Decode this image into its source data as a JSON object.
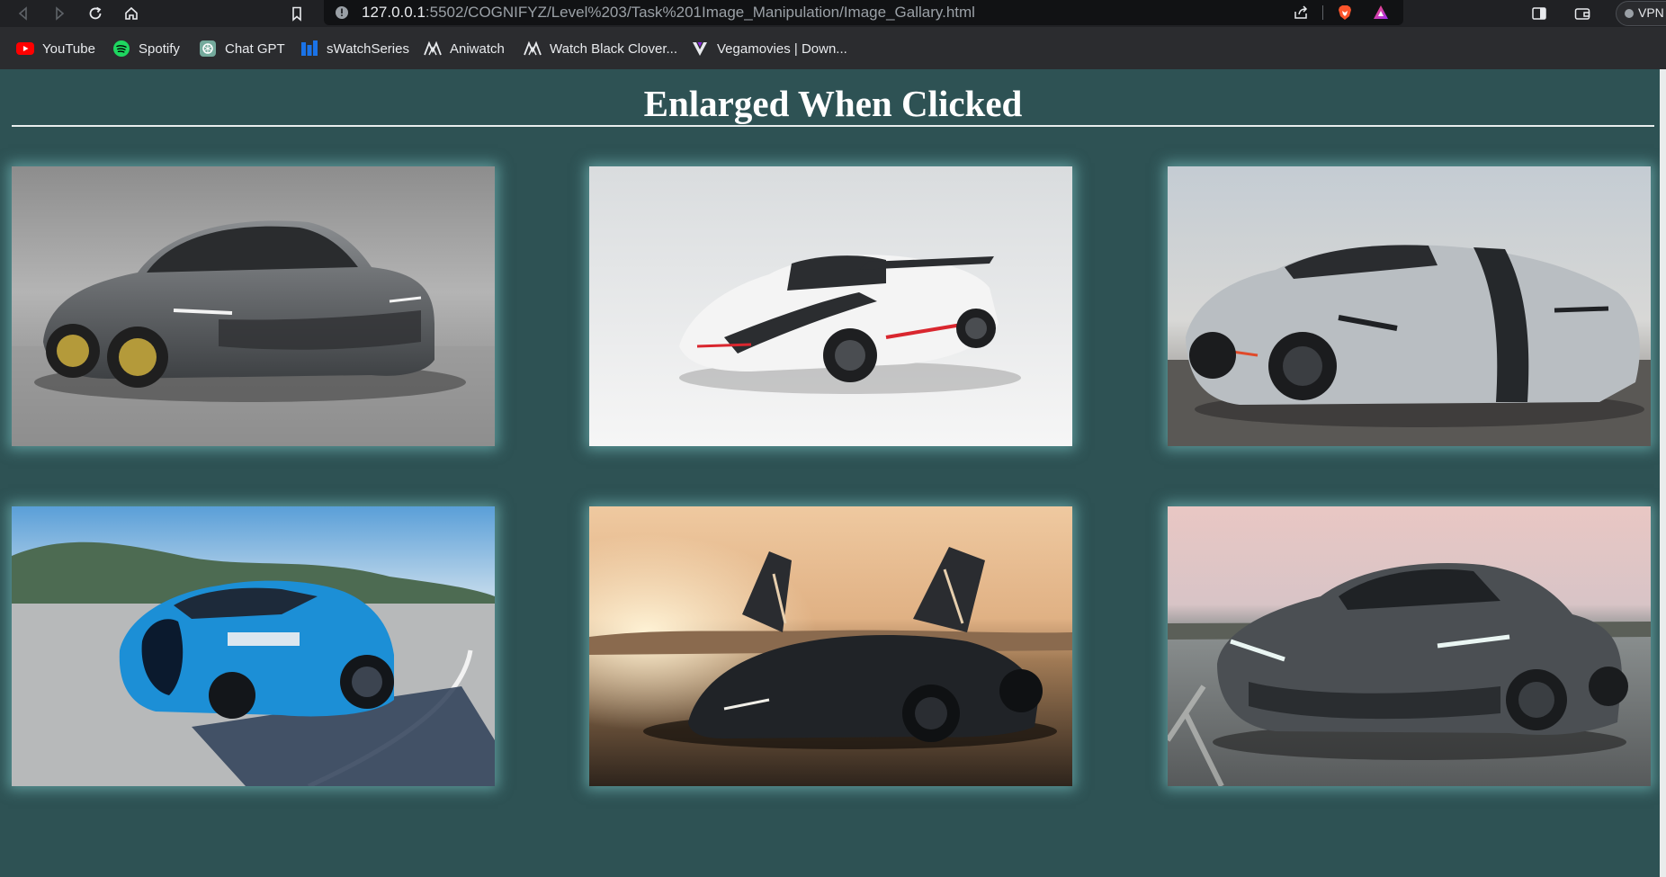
{
  "browser": {
    "url_host": "127.0.0.1",
    "url_path": ":5502/COGNIFYZ/Level%203/Task%201Image_Manipulation/Image_Gallary.html",
    "vpn_label": "VPN"
  },
  "bookmarks": [
    {
      "label": "YouTube",
      "icon": "youtube-icon"
    },
    {
      "label": "Spotify",
      "icon": "spotify-icon"
    },
    {
      "label": "Chat GPT",
      "icon": "chatgpt-icon"
    },
    {
      "label": "sWatchSeries",
      "icon": "swatchseries-icon"
    },
    {
      "label": "Aniwatch",
      "icon": "aniwatch-icon"
    },
    {
      "label": "Watch Black Clover...",
      "icon": "aniwatch-icon"
    },
    {
      "label": "Vegamovies | Down...",
      "icon": "vegamovies-icon"
    }
  ],
  "page": {
    "title": "Enlarged When Clicked",
    "background": "#2e5254",
    "images": [
      {
        "name": "gray-koenigsegg-gemera",
        "body": "#5a5d61"
      },
      {
        "name": "white-koenigsegg-one",
        "body": "#f2f2f2"
      },
      {
        "name": "silver-koenigsegg-one",
        "body": "#b8bcc0"
      },
      {
        "name": "blue-bugatti-chiron",
        "body": "#1c8fd6"
      },
      {
        "name": "black-mclaren-senna",
        "body": "#23262a"
      },
      {
        "name": "dark-koenigsegg-gemera",
        "body": "#4b4f53"
      }
    ]
  }
}
